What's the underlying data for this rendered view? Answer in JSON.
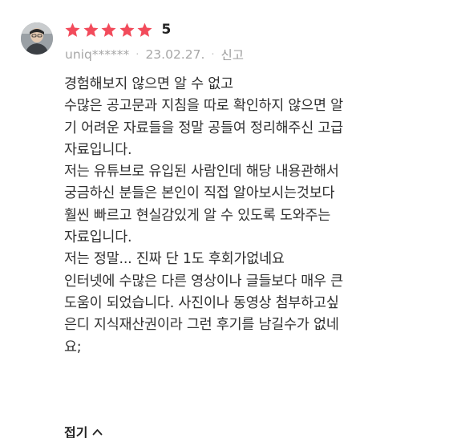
{
  "review": {
    "rating": "5",
    "stars_filled": 5,
    "star_color": "#f24b5b",
    "author": "uniq******",
    "date": "23.02.27.",
    "separator": "·",
    "report_label": "신고",
    "lines": [
      "경험해보지 않으면 알 수 없고",
      "수많은 공고문과 지침을 따로 확인하지 않으면 알",
      "기 어려운 자료들을 정말 공들여 정리해주신 고급",
      "자료입니다.",
      "저는 유튜브로 유입된 사람인데 해당 내용관해서",
      "궁금하신 분들은 본인이 직접 알아보시는것보다",
      "훨씬 빠르고 현실감있게 알 수 있도록 도와주는",
      "자료입니다.",
      "저는 정말... 진짜 단 1도 후회가없네요",
      "인터넷에 수많은 다른 영상이나 글들보다 매우 큰",
      "도움이 되었습니다. 사진이나 동영상 첨부하고싶",
      "은디 지식재산권이라 그런 후기를 남길수가 없네",
      "요;"
    ],
    "collapse_label": "접기"
  },
  "icons": {
    "star": "star-icon",
    "collapse": "chevron-up-icon",
    "avatar": "user-avatar"
  }
}
